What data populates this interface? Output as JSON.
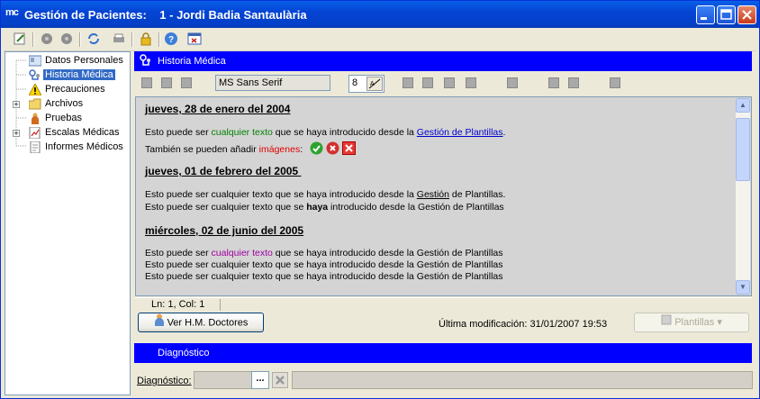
{
  "window": {
    "app_icon_text": "mc",
    "title_prefix": "Gestión de Pacientes:",
    "title_patient": "1 - Jordi Badia Santaulària"
  },
  "toolbar_icons": [
    "edit-icon",
    "circle-icon",
    "circle-icon",
    "refresh-icon",
    "print-icon",
    "lock-icon",
    "help-icon",
    "window-icon"
  ],
  "tree": {
    "items": [
      {
        "label": "Datos Personales",
        "icon": "id-card-icon",
        "expandable": false
      },
      {
        "label": "Historia Médica",
        "icon": "stethoscope-icon",
        "expandable": false,
        "selected": true
      },
      {
        "label": "Precauciones",
        "icon": "warning-icon",
        "expandable": false
      },
      {
        "label": "Archivos",
        "icon": "folder-icon",
        "expandable": true
      },
      {
        "label": "Pruebas",
        "icon": "person-icon",
        "expandable": false
      },
      {
        "label": "Escalas Médicas",
        "icon": "chart-icon",
        "expandable": true
      },
      {
        "label": "Informes Médicos",
        "icon": "document-icon",
        "expandable": false
      }
    ]
  },
  "historia": {
    "header": "Historia Médica",
    "font_name": "MS Sans Serif",
    "font_size": "8",
    "entries": [
      {
        "date": "jueves, 28 de enero del 2004"
      },
      {
        "date": "jueves, 01 de febrero del 2005 "
      },
      {
        "date": "miércoles, 02 de junio del 2005"
      }
    ],
    "e1l1": {
      "a": "Esto puede ser ",
      "b": "cualquier texto",
      "c": " que se haya introducido desde la ",
      "d": "Gestión de Plantillas",
      "e": "."
    },
    "e1l2": {
      "a": "También se pueden añadir ",
      "b": "imágenes",
      "c": ":"
    },
    "e2l1": {
      "a": "Esto puede ser cualquier texto que se haya introducido desde la ",
      "b": "Gestión",
      "c": " de Plantillas."
    },
    "e2l2": {
      "a": "Esto puede ser cualquier texto que se ",
      "b": "haya",
      "c": " introducido desde la Gestión de Plantillas"
    },
    "e3l1": {
      "a": "Esto puede ser ",
      "b": "cualquier texto",
      "c": " que se haya introducido desde la Gestión de Plantillas"
    },
    "e3l2": "Esto puede ser cualquier texto que se haya introducido desde la Gestión de Plantillas",
    "e3l3": "Esto puede ser cualquier texto que se haya introducido desde la Gestión de Plantillas",
    "status": "Ln: 1, Col: 1",
    "ver_button": "Ver H.M. Doctores",
    "last_modified": "Última modificación: 31/01/2007 19:53",
    "plantillas_button": "Plantillas"
  },
  "diagnostico": {
    "header": "Diagnóstico",
    "label": "Diagnóstico:",
    "ellipsis": "...",
    "value": ""
  }
}
